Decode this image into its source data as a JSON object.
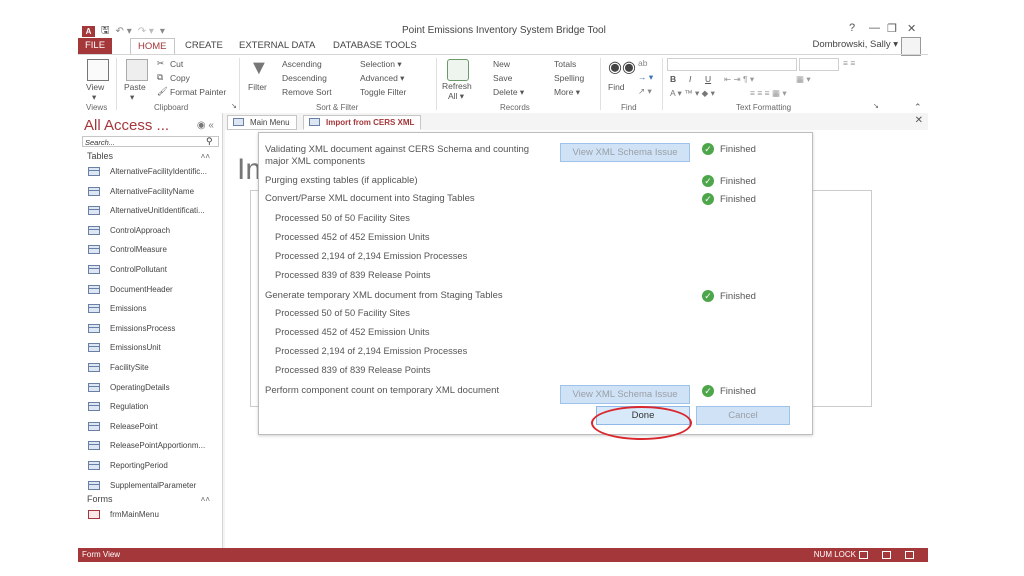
{
  "window": {
    "title": "Point Emissions Inventory System Bridge Tool",
    "help": "?",
    "user": "Dombrowski, Sally ▾"
  },
  "tabs": [
    "FILE",
    "HOME",
    "CREATE",
    "EXTERNAL DATA",
    "DATABASE TOOLS"
  ],
  "ribbon": {
    "views": {
      "view": "View",
      "group": "Views"
    },
    "clipboard": {
      "paste": "Paste",
      "cut": "Cut",
      "copy": "Copy",
      "format_painter": "Format Painter",
      "group": "Clipboard"
    },
    "sort_filter": {
      "filter": "Filter",
      "ascending": "Ascending",
      "descending": "Descending",
      "remove_sort": "Remove Sort",
      "selection": "Selection ▾",
      "advanced": "Advanced ▾",
      "toggle_filter": "Toggle Filter",
      "group": "Sort & Filter"
    },
    "records": {
      "refresh_all": "Refresh",
      "refresh_all2": "All ▾",
      "new": "New",
      "save": "Save",
      "delete": "Delete ▾",
      "totals": "Totals",
      "spelling": "Spelling",
      "more": "More ▾",
      "group": "Records"
    },
    "find": {
      "find": "Find",
      "group": "Find"
    },
    "text_formatting": {
      "group": "Text Formatting",
      "bold": "B",
      "italic": "I",
      "underline": "U"
    }
  },
  "nav": {
    "title": "All Access ...",
    "search_placeholder": "Search...",
    "tables_header": "Tables",
    "tables": [
      "AlternativeFacilityIdentific...",
      "AlternativeFacilityName",
      "AlternativeUnitIdentificati...",
      "ControlApproach",
      "ControlMeasure",
      "ControlPollutant",
      "DocumentHeader",
      "Emissions",
      "EmissionsProcess",
      "EmissionsUnit",
      "FacilitySite",
      "OperatingDetails",
      "Regulation",
      "ReleasePoint",
      "ReleasePointApportionm...",
      "ReportingPeriod",
      "SupplementalParameter"
    ],
    "forms_header": "Forms",
    "forms": [
      "frmMainMenu"
    ]
  },
  "doc_tabs": [
    "Main Menu",
    "Import from CERS XML"
  ],
  "background_title": "Im",
  "dialog": {
    "step1_line1": "Validating XML document against CERS Schema and counting",
    "step1_line2": "major XML components",
    "step2": "Purging exsting tables (if applicable)",
    "step3": "Convert/Parse XML document into Staging Tables",
    "step3_items": [
      "Processed 50 of 50 Facility Sites",
      "Processed 452 of 452 Emission Units",
      "Processed 2,194 of 2,194 Emission Processes",
      "Processed 839 of 839 Release Points"
    ],
    "step4": "Generate temporary XML document from Staging Tables",
    "step4_items": [
      "Processed 50 of 50 Facility Sites",
      "Processed 452 of 452 Emission Units",
      "Processed 2,194 of 2,194 Emission Processes",
      "Processed 839 of 839 Release Points"
    ],
    "step5": "Perform component count on temporary XML document",
    "view_issue_label": "View XML Schema Issue",
    "finished": "Finished",
    "done": "Done",
    "cancel": "Cancel"
  },
  "status": {
    "left": "Form View",
    "right": "NUM LOCK"
  },
  "colors": {
    "access_red": "#a4373a",
    "button_blue": "#cfe2f6",
    "check_green": "#4ea64a",
    "highlight_circle": "#d9272e"
  }
}
